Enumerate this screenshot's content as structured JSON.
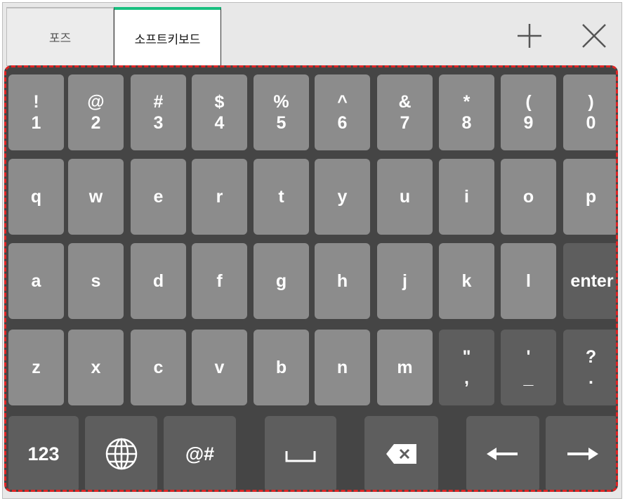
{
  "tabs": {
    "pose": "포즈",
    "keyboard": "소프트키보드"
  },
  "toolbar": {
    "add_icon": "plus-icon",
    "close_icon": "close-icon"
  },
  "colors": {
    "key": "#8c8c8c",
    "key_dark": "#5e5e5e",
    "keyboard_bg": "#454545",
    "active_tab_accent": "#19c080",
    "dashed_border": "#e02424"
  },
  "keyboard": {
    "row1": [
      {
        "top": "!",
        "bottom": "1"
      },
      {
        "top": "@",
        "bottom": "2"
      },
      {
        "top": "#",
        "bottom": "3"
      },
      {
        "top": "$",
        "bottom": "4"
      },
      {
        "top": "%",
        "bottom": "5"
      },
      {
        "top": "^",
        "bottom": "6"
      },
      {
        "top": "&",
        "bottom": "7"
      },
      {
        "top": "*",
        "bottom": "8"
      },
      {
        "top": "(",
        "bottom": "9"
      },
      {
        "top": ")",
        "bottom": "0"
      }
    ],
    "row2": [
      "q",
      "w",
      "e",
      "r",
      "t",
      "y",
      "u",
      "i",
      "o",
      "p"
    ],
    "row3": [
      "a",
      "s",
      "d",
      "f",
      "g",
      "h",
      "j",
      "k",
      "l",
      "enter"
    ],
    "row4": [
      {
        "top": "",
        "bottom": "z"
      },
      {
        "top": "",
        "bottom": "x"
      },
      {
        "top": "",
        "bottom": "c"
      },
      {
        "top": "",
        "bottom": "v"
      },
      {
        "top": "",
        "bottom": "b"
      },
      {
        "top": "",
        "bottom": "n"
      },
      {
        "top": "",
        "bottom": "m"
      },
      {
        "top": "\"",
        "bottom": ","
      },
      {
        "top": "'",
        "bottom": "_"
      },
      {
        "top": "?",
        "bottom": "."
      }
    ],
    "row5": {
      "numbers": "123",
      "globe_icon": "globe-icon",
      "symbols": "@#",
      "space_icon": "space-icon",
      "backspace_icon": "backspace-icon",
      "left_icon": "arrow-left-icon",
      "right_icon": "arrow-right-icon"
    }
  }
}
